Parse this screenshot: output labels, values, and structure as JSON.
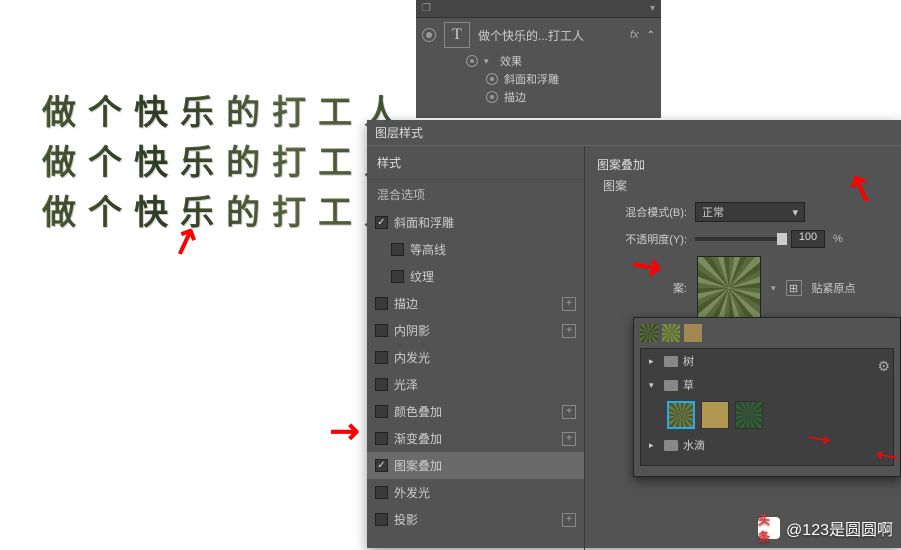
{
  "canvas": {
    "sample_text": "做个快乐的打工人"
  },
  "layers_panel": {
    "layer_type_glyph": "T",
    "layer_name": "做个快乐的...打工人",
    "fx_label": "fx",
    "effects_label": "效果",
    "bevel_label": "斜面和浮雕",
    "stroke_label": "描边"
  },
  "dialog": {
    "title": "图层样式",
    "styles_header": "样式",
    "blend_options": "混合选项",
    "items": {
      "bevel": "斜面和浮雕",
      "contour": "等高线",
      "texture": "纹理",
      "stroke": "描边",
      "inner_shadow": "内阴影",
      "inner_glow": "内发光",
      "satin": "光泽",
      "color_overlay": "颜色叠加",
      "gradient_overlay": "渐变叠加",
      "pattern_overlay": "图案叠加",
      "outer_glow": "外发光",
      "drop_shadow": "投影"
    }
  },
  "right": {
    "section": "图案叠加",
    "subsection": "图案",
    "blend_mode_label": "混合模式(B):",
    "blend_mode_value": "正常",
    "opacity_label": "不透明度(Y):",
    "opacity_value": "100",
    "opacity_unit": "%",
    "pattern_short": "案:",
    "snap_label": "贴紧原点"
  },
  "picker": {
    "folder_tree": "树",
    "folder_grass": "草",
    "folder_water": "水滴"
  },
  "watermark": {
    "badge": "头条",
    "text": "@123是圆圆啊"
  }
}
